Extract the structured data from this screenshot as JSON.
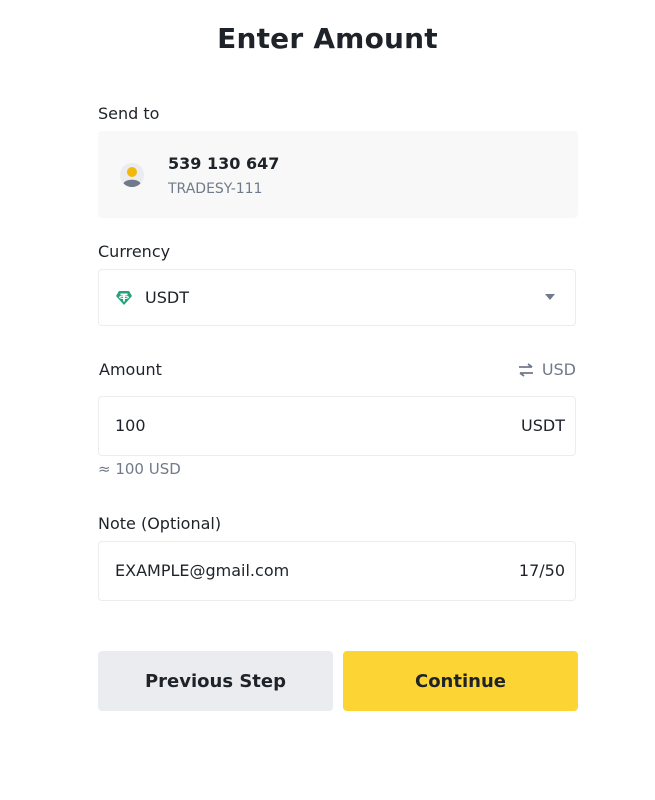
{
  "page": {
    "title": "Enter Amount"
  },
  "send_to": {
    "label": "Send to",
    "recipient_id": "539 130 647",
    "recipient_name": "TRADESY-111"
  },
  "currency": {
    "label": "Currency",
    "selected": "USDT",
    "icon": "tether-icon",
    "icon_color": "#26a17b"
  },
  "amount": {
    "label": "Amount",
    "toggle_label": "USD",
    "value": "100",
    "unit": "USDT",
    "approx": "≈ 100 USD"
  },
  "note": {
    "label": "Note (Optional)",
    "value": "EXAMPLE@gmail.com",
    "counter": "17/50"
  },
  "buttons": {
    "previous": "Previous Step",
    "continue": "Continue"
  },
  "colors": {
    "primary": "#fcd535",
    "secondary": "#eaecef",
    "text": "#1e2329",
    "muted": "#707a8a"
  }
}
